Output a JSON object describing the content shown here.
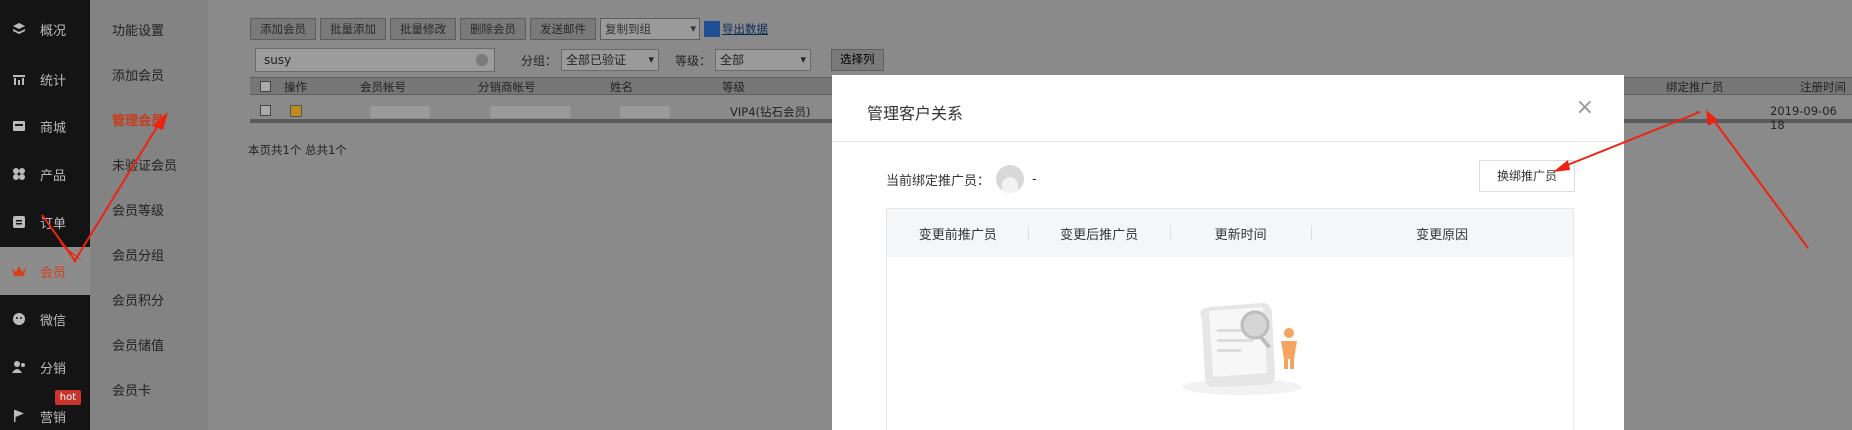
{
  "nav": {
    "items": [
      {
        "label": "概况",
        "icon": "layers-icon"
      },
      {
        "label": "统计",
        "icon": "chart-icon"
      },
      {
        "label": "商城",
        "icon": "shop-icon"
      },
      {
        "label": "产品",
        "icon": "grid-icon"
      },
      {
        "label": "订单",
        "icon": "order-icon"
      },
      {
        "label": "会员",
        "icon": "crown-icon"
      },
      {
        "label": "微信",
        "icon": "wechat-icon"
      },
      {
        "label": "分销",
        "icon": "distribution-icon"
      },
      {
        "label": "营销",
        "icon": "flag-icon"
      }
    ],
    "active_index": 5,
    "hot_badge": "hot"
  },
  "subnav": {
    "items": [
      "功能设置",
      "添加会员",
      "管理会员",
      "未验证会员",
      "会员等级",
      "会员分组",
      "会员积分",
      "会员储值",
      "会员卡"
    ],
    "active_index": 2
  },
  "toolbar": {
    "add_member": "添加会员",
    "batch_add": "批量添加",
    "batch_edit": "批量修改",
    "delete_member": "删除会员",
    "send_mail": "发送邮件",
    "copy_to_group": "复制到组",
    "export": "导出数据"
  },
  "filter": {
    "search_value": "susy",
    "group_label": "分组：",
    "group_value": "全部已验证",
    "level_label": "等级：",
    "level_value": "全部",
    "select_columns": "选择列"
  },
  "table": {
    "columns": [
      "操作",
      "会员帐号",
      "分销商帐号",
      "姓名",
      "等级",
      "绑定推广员",
      "注册时间"
    ],
    "rows": [
      {
        "level": "VIP4(钻石会员)",
        "promoter": "-",
        "reg_time": "2019-09-06 18"
      }
    ]
  },
  "pager": "本页共1个 总共1个",
  "modal": {
    "title": "管理客户关系",
    "close": "×",
    "current_promoter_label": "当前绑定推广员：",
    "current_promoter_value": "-",
    "swap_button": "换绑推广员",
    "history_columns": [
      "变更前推广员",
      "变更后推广员",
      "更新时间",
      "变更原因"
    ]
  },
  "colors": {
    "active_red": "#d4421d",
    "annotation_red": "#ee2211"
  }
}
